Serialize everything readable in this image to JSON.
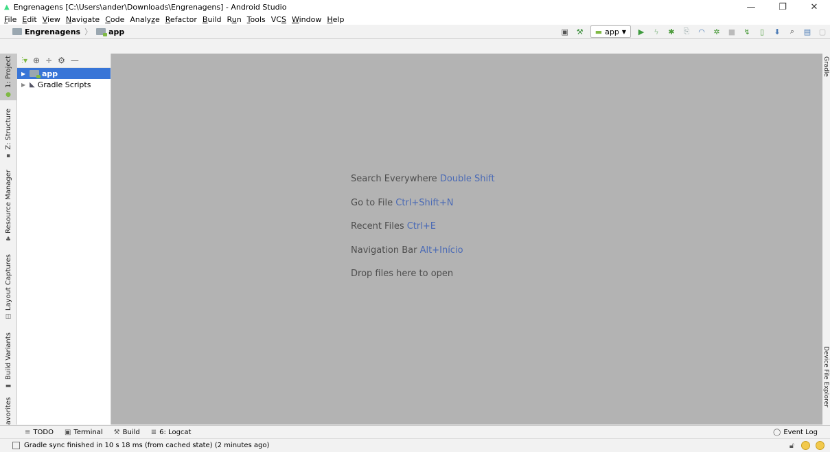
{
  "window": {
    "title": "Engrenagens [C:\\Users\\ander\\Downloads\\Engrenagens] - Android Studio",
    "minimize": "—",
    "maximize": "❐",
    "close": "✕"
  },
  "menu": [
    {
      "u": "F",
      "rest": "ile"
    },
    {
      "u": "E",
      "rest": "dit"
    },
    {
      "u": "V",
      "rest": "iew"
    },
    {
      "u": "N",
      "rest": "avigate"
    },
    {
      "u": "C",
      "rest": "ode"
    },
    {
      "pre": "Analy",
      "u": "z",
      "rest": "e"
    },
    {
      "u": "R",
      "rest": "efactor"
    },
    {
      "u": "B",
      "rest": "uild"
    },
    {
      "pre": "R",
      "u": "u",
      "rest": "n"
    },
    {
      "u": "T",
      "rest": "ools"
    },
    {
      "pre": "VC",
      "u": "S",
      "rest": ""
    },
    {
      "u": "W",
      "rest": "indow"
    },
    {
      "u": "H",
      "rest": "elp"
    }
  ],
  "breadcrumb": {
    "project": "Engrenagens",
    "module": "app"
  },
  "toolbar": {
    "run_config": "app"
  },
  "left_stripe": {
    "project": "1: Project",
    "structure": "Z: Structure",
    "resource_manager": "Resource Manager",
    "layout_captures": "Layout Captures",
    "build_variants": "Build Variants",
    "favorites": "avorites"
  },
  "project_tree": [
    {
      "label": "app",
      "selected": true
    },
    {
      "label": "Gradle Scripts",
      "selected": false
    }
  ],
  "editor_hints": [
    {
      "text": "Search Everywhere",
      "key": "Double Shift"
    },
    {
      "text": "Go to File",
      "key": "Ctrl+Shift+N"
    },
    {
      "text": "Recent Files",
      "key": "Ctrl+E"
    },
    {
      "text": "Navigation Bar",
      "key": "Alt+Início"
    },
    {
      "text": "Drop files here to open",
      "key": ""
    }
  ],
  "right_stripe": {
    "gradle": "Gradle",
    "device_file_explorer": "Device File Explorer"
  },
  "bottom_tabs": {
    "todo": "TODO",
    "terminal": "Terminal",
    "build": "Build",
    "logcat": "6: Logcat",
    "event_log": "Event Log"
  },
  "status": {
    "message": "Gradle sync finished in 10 s 18 ms (from cached state) (2 minutes ago)"
  },
  "colors": {
    "selection": "#3875d7",
    "editor_bg": "#b3b3b3",
    "shortcut": "#4a6ab5",
    "android_green": "#7fb944"
  }
}
